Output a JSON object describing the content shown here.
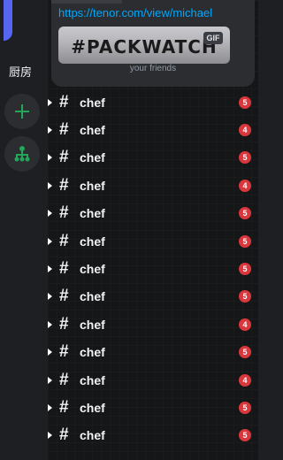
{
  "card": {
    "link": "https://tenor.com/view/michael",
    "gif_text": "#PACKWATCH",
    "gif_badge": "GIF",
    "footer": "your friends"
  },
  "rail": {
    "label": "厨房",
    "add_icon": "plus-icon",
    "discover_icon": "hierarchy-icon"
  },
  "channels": [
    {
      "name": "chef",
      "badge": "5"
    },
    {
      "name": "chef",
      "badge": "4"
    },
    {
      "name": "chef",
      "badge": "5"
    },
    {
      "name": "chef",
      "badge": "4"
    },
    {
      "name": "chef",
      "badge": "5"
    },
    {
      "name": "chef",
      "badge": "5"
    },
    {
      "name": "chef",
      "badge": "5"
    },
    {
      "name": "chef",
      "badge": "5"
    },
    {
      "name": "chef",
      "badge": "4"
    },
    {
      "name": "chef",
      "badge": "5"
    },
    {
      "name": "chef",
      "badge": "4"
    },
    {
      "name": "chef",
      "badge": "5"
    },
    {
      "name": "chef",
      "badge": "5"
    }
  ],
  "colors": {
    "accent": "#5865f2",
    "badge": "#da373c",
    "link": "#00a8fc",
    "green": "#23a55a"
  }
}
